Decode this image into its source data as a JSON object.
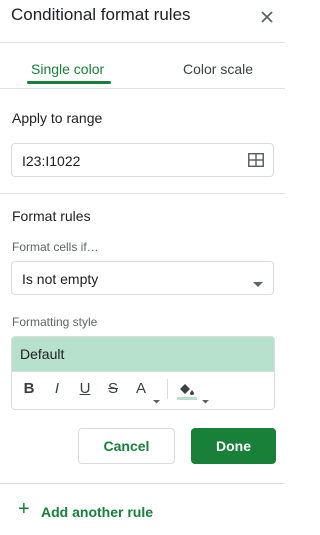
{
  "header": {
    "title": "Conditional format rules",
    "close_icon": "close-icon"
  },
  "tabs": [
    {
      "label": "Single color",
      "active": true
    },
    {
      "label": "Color scale",
      "active": false
    }
  ],
  "apply_to_range": {
    "heading": "Apply to range",
    "value": "I23:I1022",
    "icon": "grid-select-icon"
  },
  "format_rules": {
    "heading": "Format rules",
    "condition_label": "Format cells if…",
    "condition_value": "Is not empty",
    "dropdown_icon": "dropdown-caret-icon"
  },
  "formatting_style": {
    "label": "Formatting style",
    "preview_text": "Default",
    "preview_color": "#b7e1cd",
    "toolbar": {
      "bold": "B",
      "italic": "I",
      "underline": "U",
      "strikethrough": "S",
      "text_color": "A"
    }
  },
  "actions": {
    "cancel": "Cancel",
    "done": "Done"
  },
  "add_rule": {
    "plus": "+",
    "label": "Add another rule"
  },
  "colors": {
    "accent": "#188038",
    "border": "#dadce0"
  }
}
